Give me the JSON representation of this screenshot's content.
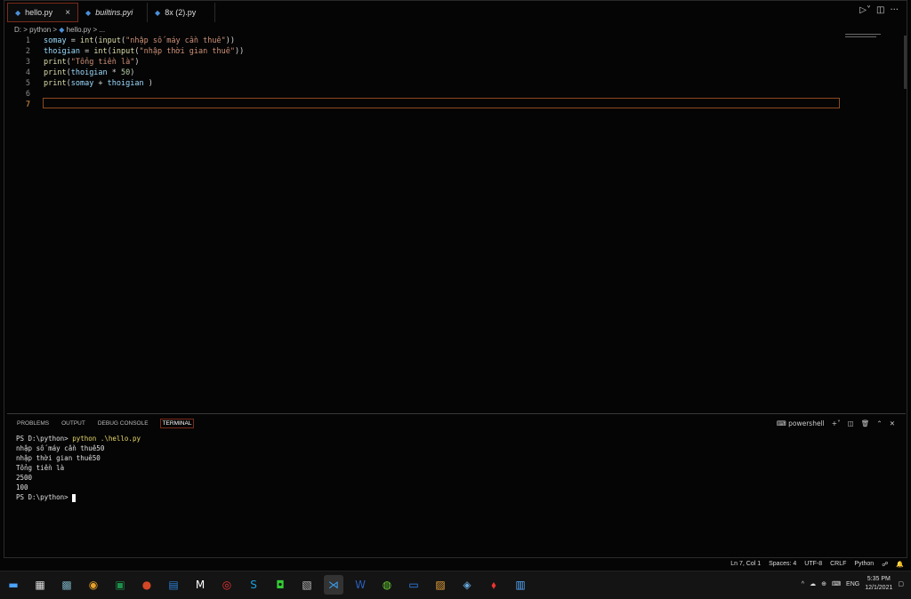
{
  "tabs": [
    {
      "label": "hello.py",
      "active": true,
      "close": "×"
    },
    {
      "label": "builtins.pyi",
      "active": false
    },
    {
      "label": "8x (2).py",
      "active": false
    }
  ],
  "breadcrumb": {
    "drive": "D:",
    "folder": "python",
    "file": "hello.py",
    "more": "..."
  },
  "editor": {
    "lines": [
      {
        "n": "1",
        "parts": [
          {
            "t": "somay",
            "c": "var"
          },
          {
            "t": " = ",
            "c": "plain"
          },
          {
            "t": "int",
            "c": "fn"
          },
          {
            "t": "(",
            "c": "plain"
          },
          {
            "t": "input",
            "c": "fn"
          },
          {
            "t": "(",
            "c": "plain"
          },
          {
            "t": "\"nhập số máy cần thuê\"",
            "c": "str"
          },
          {
            "t": "))",
            "c": "plain"
          }
        ]
      },
      {
        "n": "2",
        "parts": [
          {
            "t": "thoigian",
            "c": "var"
          },
          {
            "t": " = ",
            "c": "plain"
          },
          {
            "t": "int",
            "c": "fn"
          },
          {
            "t": "(",
            "c": "plain"
          },
          {
            "t": "input",
            "c": "fn"
          },
          {
            "t": "(",
            "c": "plain"
          },
          {
            "t": "\"nhập thời gian thuê\"",
            "c": "str"
          },
          {
            "t": "))",
            "c": "plain"
          }
        ]
      },
      {
        "n": "3",
        "parts": [
          {
            "t": "print",
            "c": "fn"
          },
          {
            "t": "(",
            "c": "plain"
          },
          {
            "t": "\"Tổng tiền là\"",
            "c": "str"
          },
          {
            "t": ")",
            "c": "plain"
          }
        ]
      },
      {
        "n": "4",
        "parts": [
          {
            "t": "print",
            "c": "fn"
          },
          {
            "t": "(",
            "c": "plain"
          },
          {
            "t": "thoigian",
            "c": "var"
          },
          {
            "t": " * ",
            "c": "plain"
          },
          {
            "t": "50",
            "c": "num"
          },
          {
            "t": ")",
            "c": "plain"
          }
        ]
      },
      {
        "n": "5",
        "parts": [
          {
            "t": "print",
            "c": "fn"
          },
          {
            "t": "(",
            "c": "plain"
          },
          {
            "t": "somay",
            "c": "var"
          },
          {
            "t": " + ",
            "c": "plain"
          },
          {
            "t": "thoigian",
            "c": "var"
          },
          {
            "t": " )",
            "c": "plain"
          }
        ]
      },
      {
        "n": "6",
        "parts": []
      },
      {
        "n": "7",
        "parts": [],
        "current": true
      }
    ]
  },
  "panel": {
    "tabs": [
      "PROBLEMS",
      "OUTPUT",
      "DEBUG CONSOLE",
      "TERMINAL"
    ],
    "active_tab": "TERMINAL",
    "shell": "powershell",
    "terminal": [
      {
        "prompt": "PS D:\\python> ",
        "cmd": "python .\\hello.py"
      },
      {
        "text": "nhập số máy cần thuê50"
      },
      {
        "text": "nhập thời gian thuê50"
      },
      {
        "text": "Tổng tiền là"
      },
      {
        "text": "2500"
      },
      {
        "text": "100"
      },
      {
        "prompt": "PS D:\\python> ",
        "cursor": true
      }
    ]
  },
  "status": {
    "position": "Ln 7, Col 1",
    "spaces": "Spaces: 4",
    "encoding": "UTF-8",
    "eol": "CRLF",
    "language": "Python"
  },
  "taskbar": {
    "lang": "ENG",
    "time": "5:35 PM",
    "date": "12/1/2021"
  }
}
